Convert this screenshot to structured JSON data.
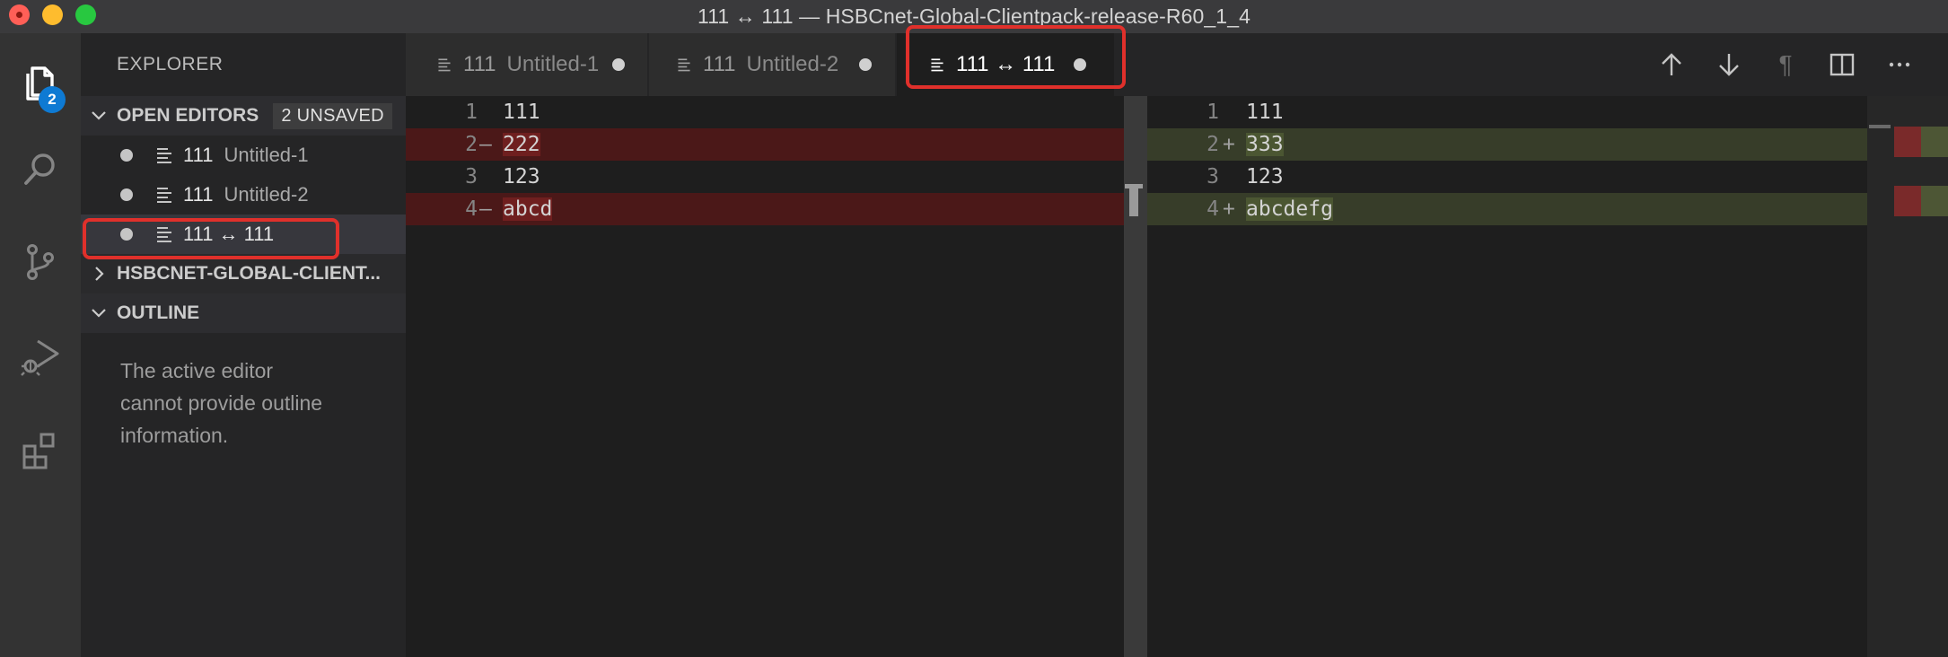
{
  "window": {
    "title": "111 ↔ 111 — HSBCnet-Global-Clientpack-release-R60_1_4"
  },
  "activity_bar": {
    "explorer_badge": "2",
    "items": [
      "files-icon",
      "search-icon",
      "source-control-icon",
      "run-debug-icon",
      "extensions-icon"
    ]
  },
  "sidebar": {
    "title": "EXPLORER",
    "open_editors": {
      "label": "OPEN EDITORS",
      "unsaved": "2 UNSAVED",
      "items": [
        {
          "name": "111",
          "desc": "Untitled-1"
        },
        {
          "name": "111",
          "desc": "Untitled-2"
        },
        {
          "name": "111 ↔ 111",
          "desc": ""
        }
      ]
    },
    "project_label": "HSBCNET-GLOBAL-CLIENT...",
    "outline": {
      "label": "OUTLINE",
      "message_lines": [
        "The active editor",
        "cannot provide outline",
        "information."
      ]
    }
  },
  "tabs": [
    {
      "name": "111",
      "desc": "Untitled-1"
    },
    {
      "name": "111",
      "desc": "Untitled-2"
    },
    {
      "name": "111 ↔ 111",
      "desc": ""
    }
  ],
  "tab_actions": [
    "previous-change-icon",
    "next-change-icon",
    "show-whitespace-icon",
    "split-editor-icon",
    "more-actions-icon"
  ],
  "diff": {
    "left": [
      {
        "num": "1",
        "mark": "",
        "text": "111"
      },
      {
        "num": "2",
        "mark": "—",
        "text": "222"
      },
      {
        "num": "3",
        "mark": "",
        "text": "123"
      },
      {
        "num": "4",
        "mark": "—",
        "text": "abcd"
      }
    ],
    "right": [
      {
        "num": "1",
        "mark": "",
        "text": "111"
      },
      {
        "num": "2",
        "mark": "+",
        "text": "333"
      },
      {
        "num": "3",
        "mark": "",
        "text": "123"
      },
      {
        "num": "4",
        "mark": "+",
        "text": "abcdefg"
      }
    ]
  },
  "colors": {
    "removed_line": "#4b1818",
    "added_line": "#373d29",
    "highlight_box": "#e0302b",
    "badge": "#0e7ad3"
  }
}
